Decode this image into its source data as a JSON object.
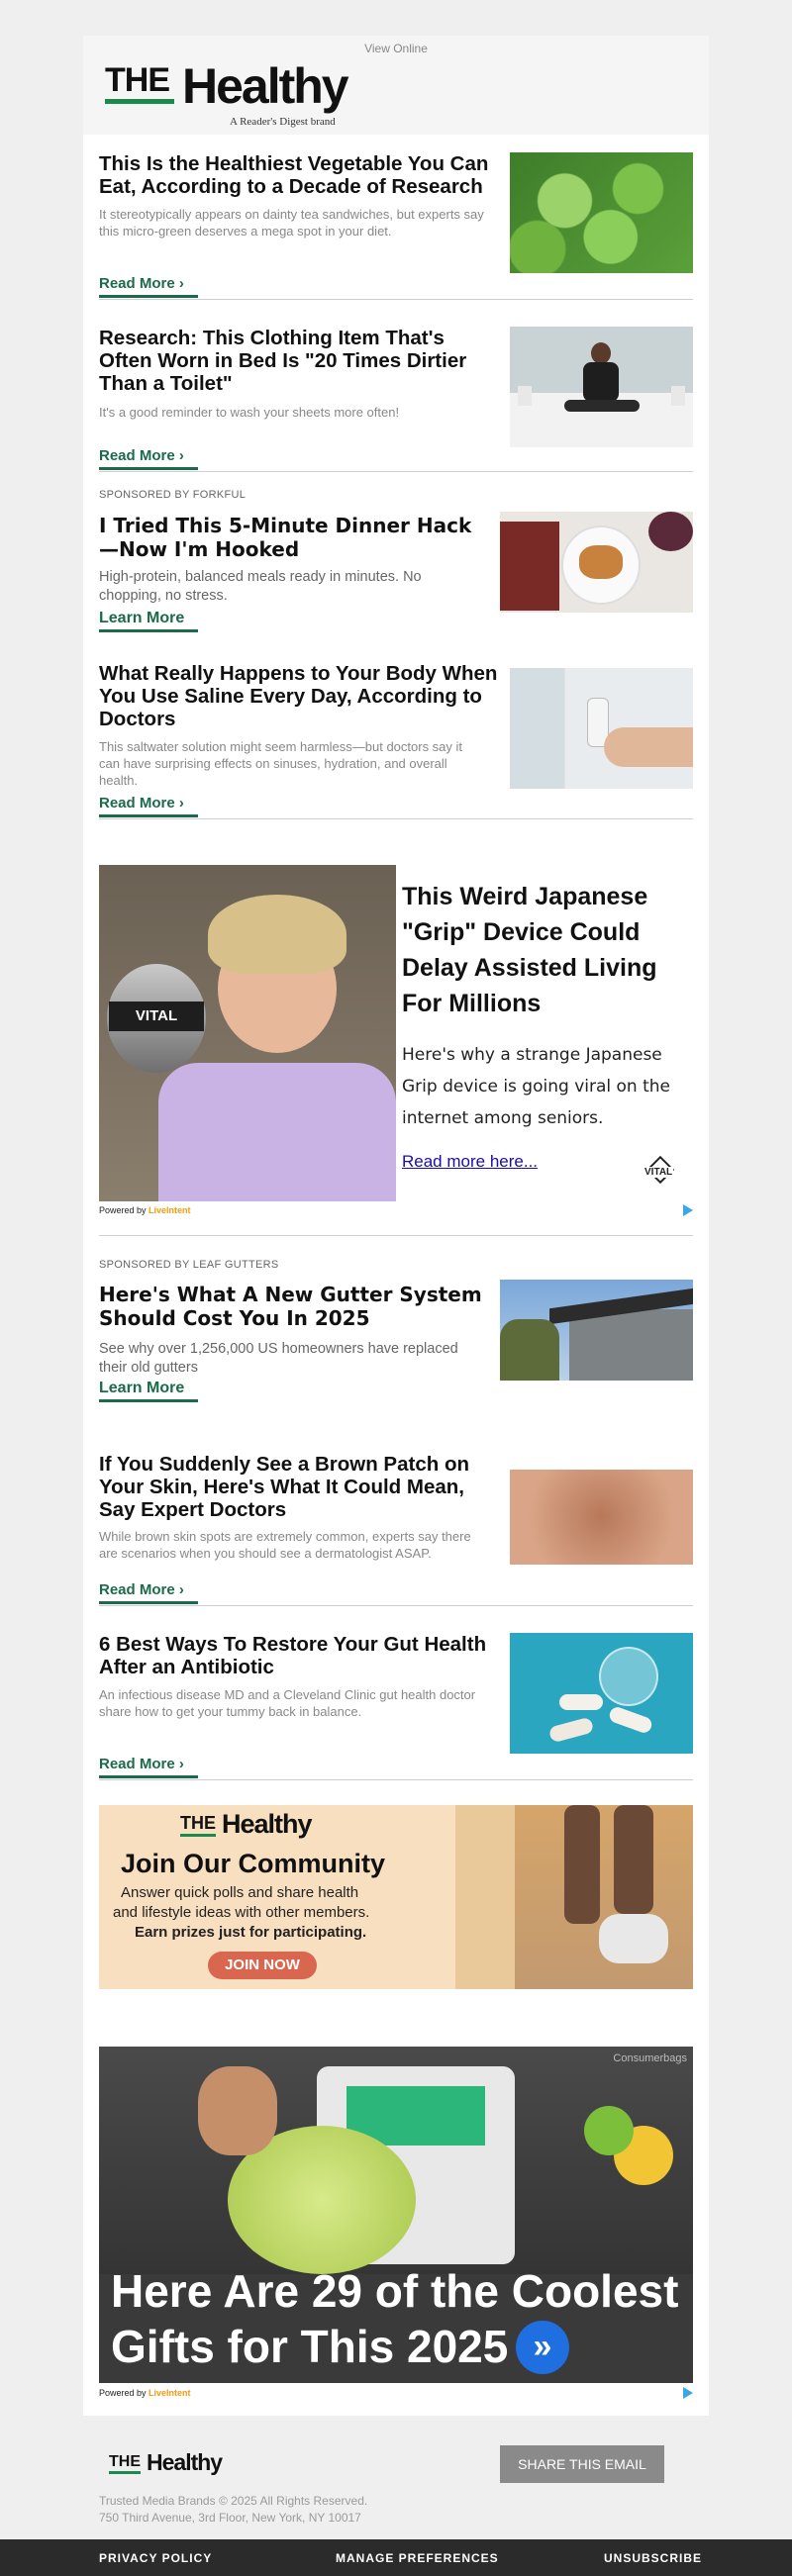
{
  "header": {
    "view_online": "View Online",
    "logo_the": "THE",
    "logo_healthy": "Healthy",
    "logo_sub": "A Reader's Digest brand"
  },
  "articles": [
    {
      "title": "This Is the Healthiest Vegetable You Can Eat, According to a Decade of Research",
      "desc": "It stereotypically appears on dainty tea sandwiches, but experts say this micro-green deserves a mega spot in your diet.",
      "cta": "Read More ›",
      "image": "microgreens-photo"
    },
    {
      "title": "Research: This Clothing Item That's Often Worn in Bed Is \"20 Times Dirtier Than a Toilet\"",
      "desc": "It's a good reminder to wash your sheets more often!",
      "cta": "Read More ›",
      "image": "woman-meditating-on-bed-photo"
    },
    {
      "sponsor": "SPONSORED BY FORKFUL",
      "title": "I Tried This 5-Minute Dinner Hack—Now I'm Hooked",
      "desc": "High-protein, balanced meals ready in minutes. No chopping, no stress.",
      "cta": "Learn More",
      "image": "dinner-plate-photo"
    },
    {
      "title": "What Really Happens to Your Body When You Use Saline Every Day, According to Doctors",
      "desc": "This saltwater solution might seem harmless—but doctors say it can have surprising effects on sinuses, hydration, and overall health.",
      "cta": "Read More ›",
      "image": "saline-spray-photo"
    },
    {
      "sponsor": "SPONSORED BY LEAF GUTTERS",
      "title": "Here's What A New Gutter System Should Cost You In 2025",
      "desc": "See why over 1,256,000 US homeowners have replaced their old gutters",
      "cta": "Learn More",
      "image": "house-gutter-photo"
    },
    {
      "title": "If You Suddenly See a Brown Patch on Your Skin, Here's What It Could Mean, Say Expert Doctors",
      "desc": "While brown skin spots are extremely common, experts say there are scenarios when you should see a dermatologist ASAP.",
      "cta": "Read More ›",
      "image": "skin-patch-photo"
    },
    {
      "title": "6 Best Ways To Restore Your Gut Health After an Antibiotic",
      "desc": "An infectious disease MD and a Cleveland Clinic gut health doctor share how to get your tummy back in balance.",
      "cta": "Read More ›",
      "image": "pills-jar-photo"
    }
  ],
  "ad1": {
    "title": "This Weird Japanese \"Grip\" Device Could Delay Assisted Living For Millions",
    "text": "Here's why a strange Japanese Grip device is going viral on the internet among seniors.",
    "link": "Read more here...",
    "device_label": "VITAL",
    "brand_logo": "VITAL",
    "powered_prefix": "Powered by",
    "powered_brand": "LiveIntent"
  },
  "community": {
    "logo_the": "THE",
    "logo_healthy": "Healthy",
    "title": "Join Our Community",
    "line1": "Answer quick polls and share health",
    "line2": "and lifestyle ideas with other members.",
    "line3": "Earn prizes just for participating.",
    "button": "JOIN NOW"
  },
  "ad2": {
    "source": "Consumerbags",
    "headline_line1": "Here Are 29 of the Coolest",
    "headline_line2": "Gifts for This 2025",
    "powered_prefix": "Powered by",
    "powered_brand": "LiveIntent"
  },
  "footer": {
    "logo_the": "THE",
    "logo_healthy": "Healthy",
    "share": "SHARE THIS EMAIL",
    "copyright": "Trusted Media Brands © 2025 All Rights Reserved.",
    "address": "750 Third Avenue, 3rd Floor, New York, NY 10017",
    "privacy": "PRIVACY POLICY",
    "preferences": "MANAGE PREFERENCES",
    "unsubscribe": "UNSUBSCRIBE"
  },
  "colors": {
    "accent_green": "#1b6b4a",
    "logo_green": "#1a8a4f",
    "join_button": "#d9674f",
    "footer_bar": "#2b2b2b"
  }
}
